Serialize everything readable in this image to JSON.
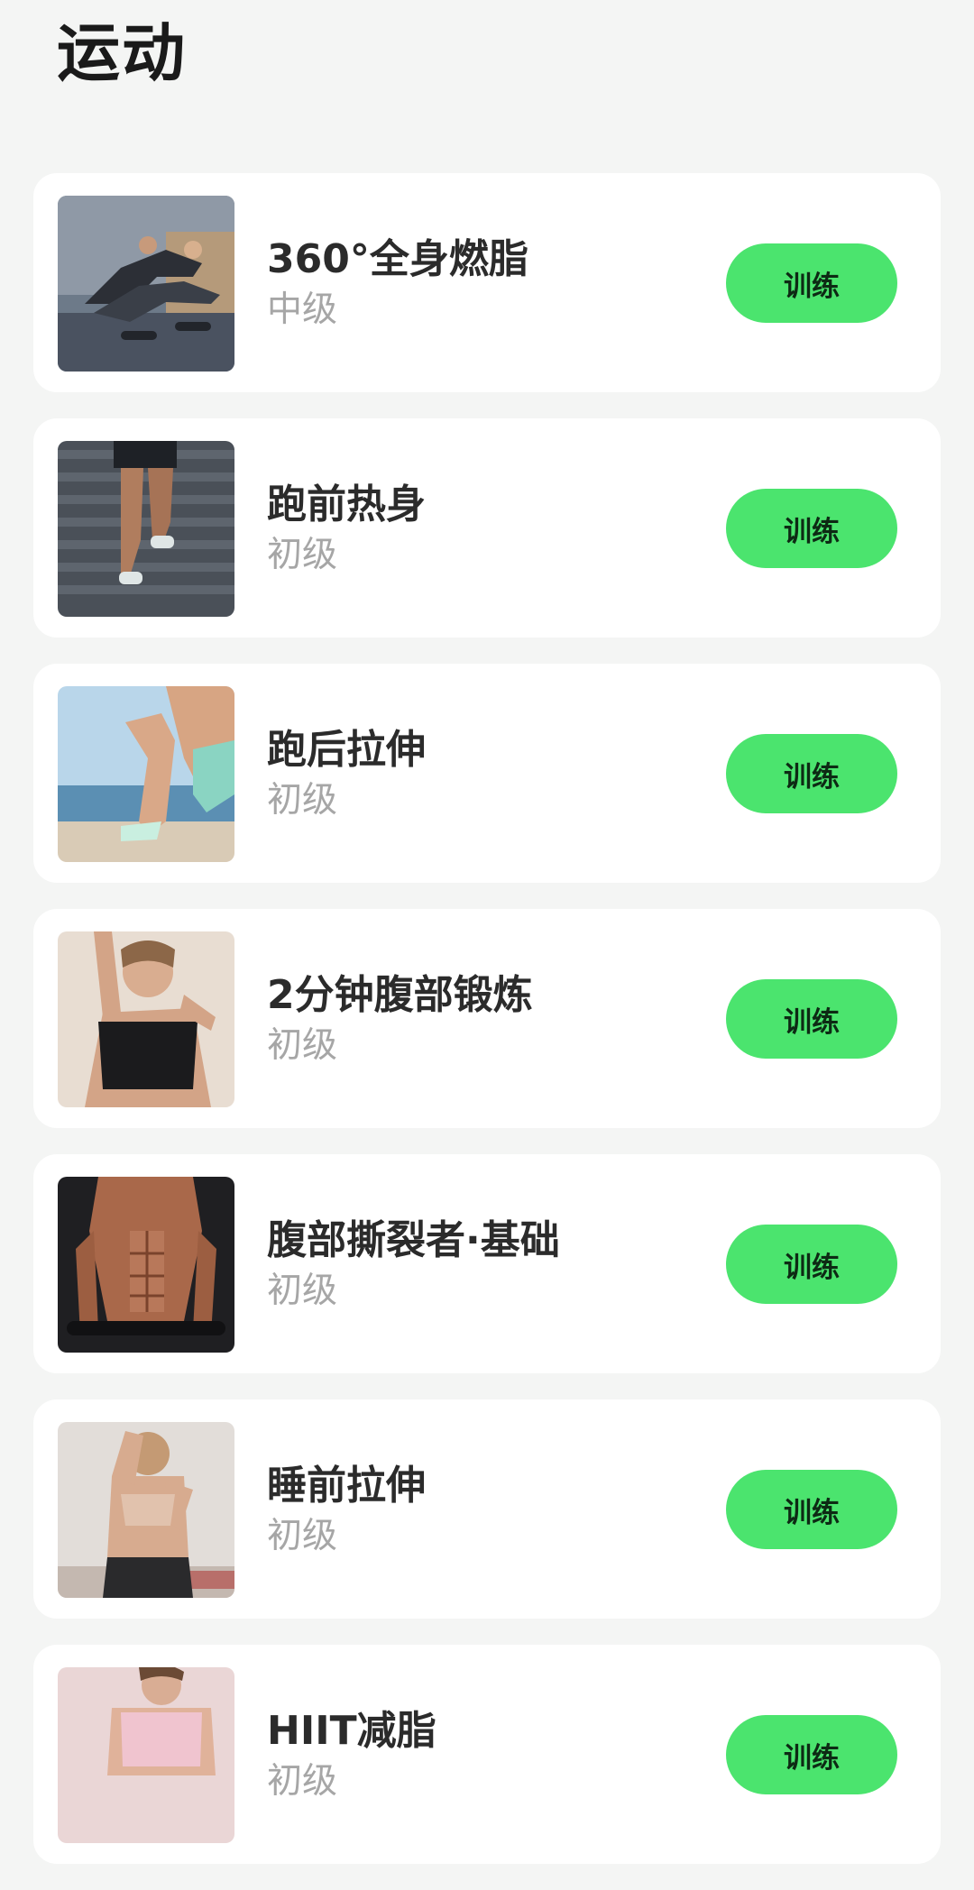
{
  "header": {
    "title": "运动"
  },
  "workouts": [
    {
      "title": "360°全身燃脂",
      "level": "中级",
      "button_label": "训练",
      "image": "couple-plank-dumbbell-photo"
    },
    {
      "title": "跑前热身",
      "level": "初级",
      "button_label": "训练",
      "image": "stair-running-legs-photo"
    },
    {
      "title": "跑后拉伸",
      "level": "初级",
      "button_label": "训练",
      "image": "beach-leg-stretch-photo"
    },
    {
      "title": "2分钟腹部锻炼",
      "level": "初级",
      "button_label": "训练",
      "image": "woman-sports-bra-photo"
    },
    {
      "title": "腹部撕裂者·基础",
      "level": "初级",
      "button_label": "训练",
      "image": "muscular-man-abs-photo"
    },
    {
      "title": "睡前拉伸",
      "level": "初级",
      "button_label": "训练",
      "image": "back-arm-stretch-photo"
    },
    {
      "title": "HIIT减脂",
      "level": "初级",
      "button_label": "训练",
      "image": "woman-pink-top-photo"
    }
  ],
  "colors": {
    "background": "#f4f5f4",
    "card": "#ffffff",
    "accent": "#4be46e",
    "title_text": "#2b2b2b",
    "level_text": "#a6a6a6"
  }
}
